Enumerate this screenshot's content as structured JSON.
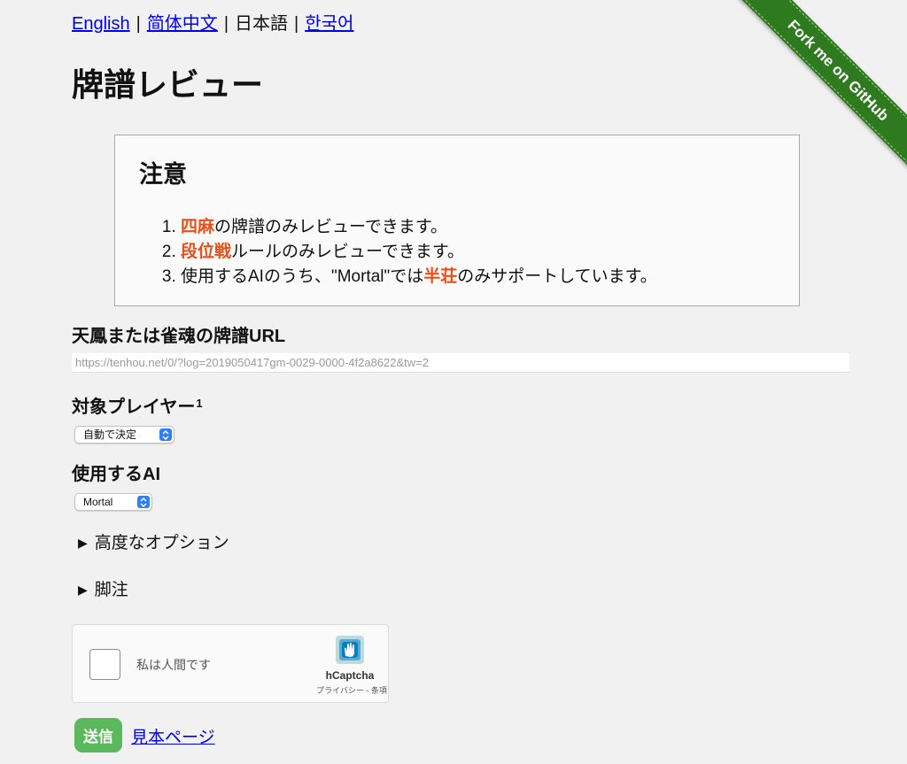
{
  "languages": {
    "english": "English",
    "chinese_simplified": "简体中文",
    "japanese": "日本語",
    "korean": "한국어",
    "separator": "|"
  },
  "ribbon": {
    "label": "Fork me on GitHub",
    "color": "#2d7a1f"
  },
  "title": "牌譜レビュー",
  "notice": {
    "heading": "注意",
    "items": [
      {
        "highlight": "四麻",
        "text": "の牌譜のみレビューできます。"
      },
      {
        "highlight": "段位戦",
        "text": "ルールのみレビューできます。"
      },
      {
        "prefix": "使用するAIのうち、\"Mortal\"では",
        "highlight": "半荘",
        "text": "のみサポートしています。"
      }
    ],
    "highlight_color": "#e8501a"
  },
  "form": {
    "url_label": "天鳳または雀魂の牌譜URL",
    "url_placeholder": "https://tenhou.net/0/?log=2019050417gm-0029-0000-4f2a8622&tw=2",
    "player_label": "対象プレイヤー",
    "player_footnote_mark": "1",
    "player_selected": "自動で決定",
    "ai_label": "使用するAI",
    "ai_selected": "Mortal",
    "advanced_options": "高度なオプション",
    "footnotes": "脚注",
    "submit_label": "送信",
    "submit_color": "#5cb85c",
    "sample_link": "見本ページ"
  },
  "captcha": {
    "checkbox_text": "私は人間です",
    "brand": "hCaptcha",
    "privacy": "プライバシー",
    "terms_separator": "-",
    "terms": "条項"
  }
}
